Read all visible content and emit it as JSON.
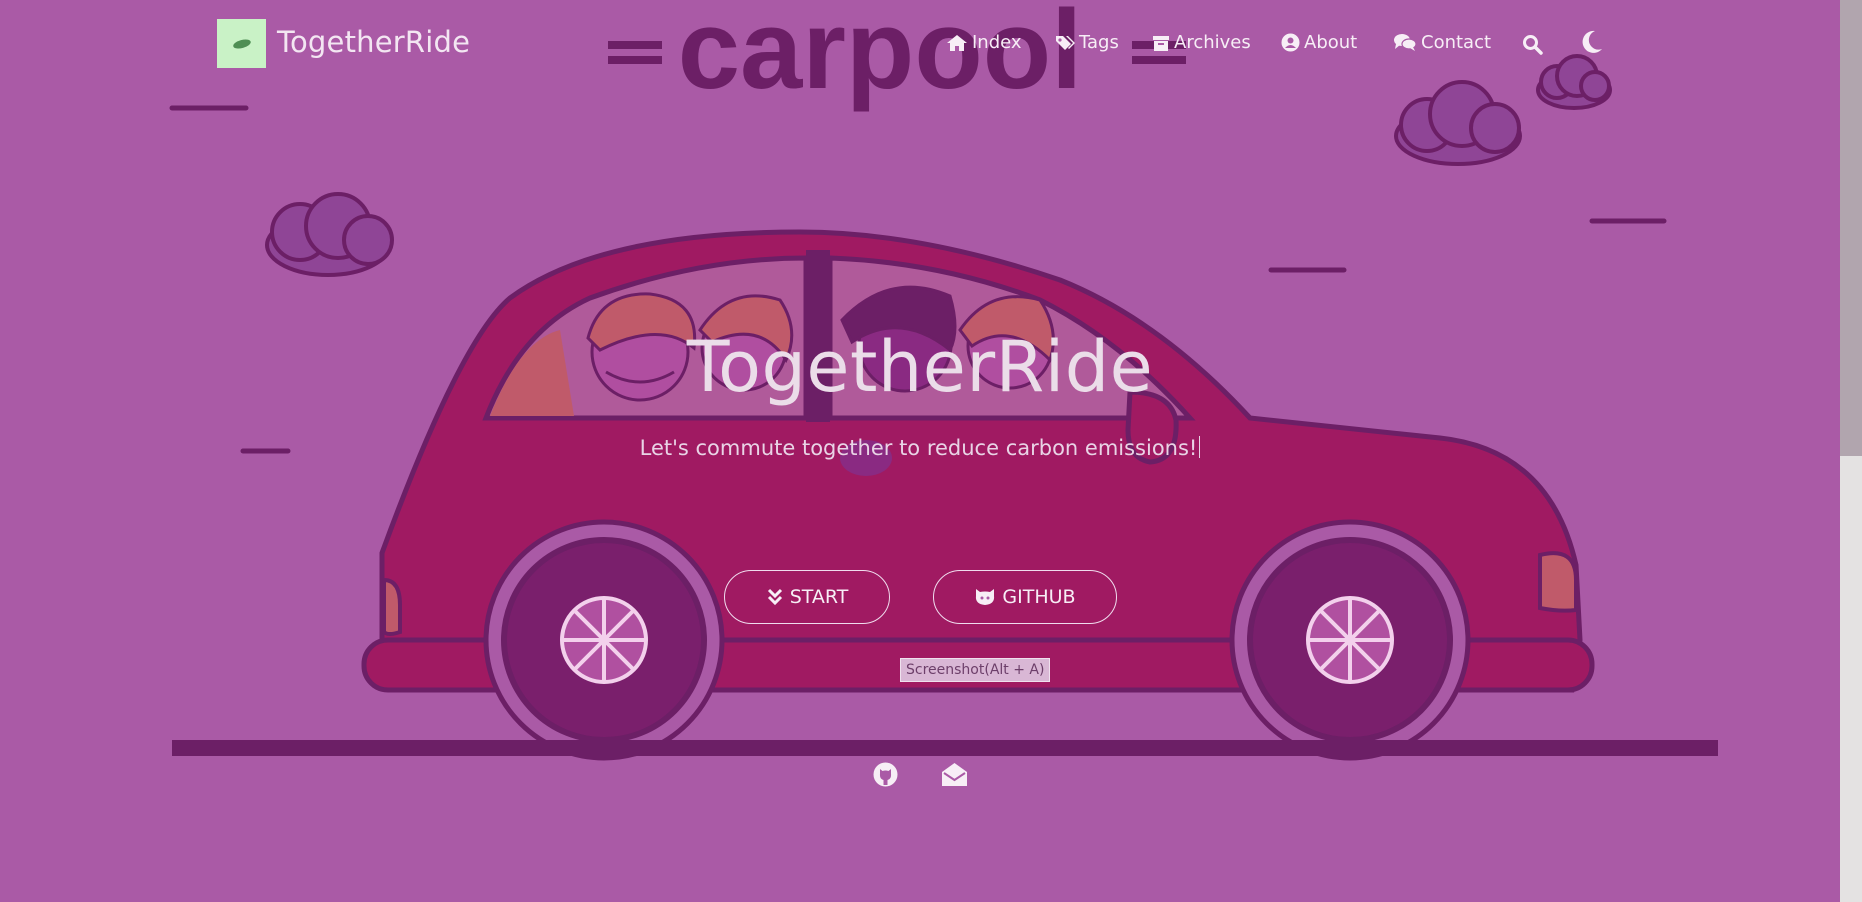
{
  "colors": {
    "background": "#aa5aa6",
    "car_body": "#a01a62",
    "text": "#f3e6f2",
    "wheel": "#7a1f6c"
  },
  "hero_art": {
    "banner_text": "carpool"
  },
  "header": {
    "brand": "TogetherRide",
    "nav": [
      {
        "icon": "home-icon",
        "label": "Index"
      },
      {
        "icon": "tags-icon",
        "label": "Tags"
      },
      {
        "icon": "archive-icon",
        "label": "Archives"
      },
      {
        "icon": "user-circle-icon",
        "label": "About"
      },
      {
        "icon": "comments-icon",
        "label": "Contact"
      }
    ],
    "search_icon": "search-icon",
    "theme_icon": "moon-icon"
  },
  "hero": {
    "title": "TogetherRide",
    "subtitle": "Let's commute together to reduce carbon emissions!",
    "buttons": [
      {
        "icon": "double-chevron-down-icon",
        "label": "START"
      },
      {
        "icon": "github-icon",
        "label": "GITHUB"
      }
    ]
  },
  "tooltip": {
    "text": "Screenshot(Alt + A)"
  },
  "social": [
    {
      "icon": "github-icon"
    },
    {
      "icon": "envelope-open-icon"
    }
  ]
}
